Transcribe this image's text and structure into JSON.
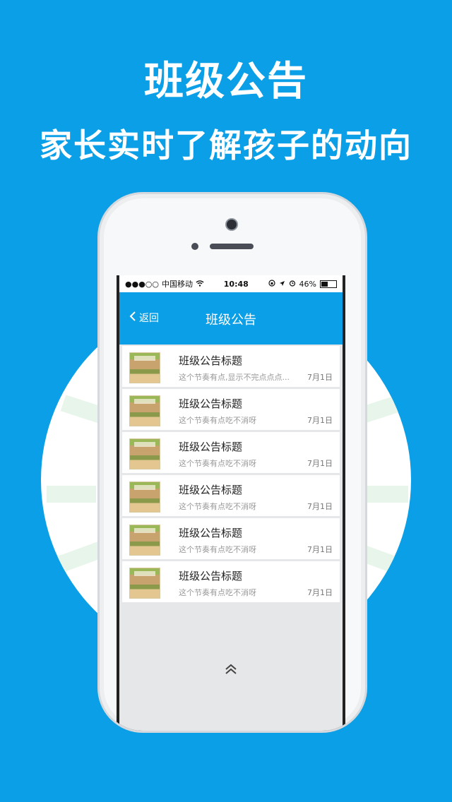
{
  "promo": {
    "headline": "班级公告",
    "subheadline": "家长实时了解孩子的动向"
  },
  "status_bar": {
    "signal": "●●●○○",
    "carrier": "中国移动",
    "time": "10:48",
    "battery": "46%"
  },
  "nav": {
    "back_label": "返回",
    "title": "班级公告"
  },
  "announcements": [
    {
      "title": "班级公告标题",
      "summary": "这个节奏有点,显示不完点点点...",
      "date": "7月1日"
    },
    {
      "title": "班级公告标题",
      "summary": "这个节奏有点吃不消呀",
      "date": "7月1日"
    },
    {
      "title": "班级公告标题",
      "summary": "这个节奏有点吃不消呀",
      "date": "7月1日"
    },
    {
      "title": "班级公告标题",
      "summary": "这个节奏有点吃不消呀",
      "date": "7月1日"
    },
    {
      "title": "班级公告标题",
      "summary": "这个节奏有点吃不消呀",
      "date": "7月1日"
    },
    {
      "title": "班级公告标题",
      "summary": "这个节奏有点吃不消呀",
      "date": "7月1日"
    }
  ],
  "icons": {
    "back": "chevron-left-icon",
    "wifi": "wifi-icon",
    "lock_rotation": "rotation-lock-icon",
    "location": "location-arrow-icon",
    "alarm": "alarm-icon",
    "battery": "battery-icon",
    "pull_up": "double-chevron-up-icon"
  },
  "colors": {
    "brand_blue": "#0a9fe6",
    "list_bg": "#e6e7e8"
  }
}
